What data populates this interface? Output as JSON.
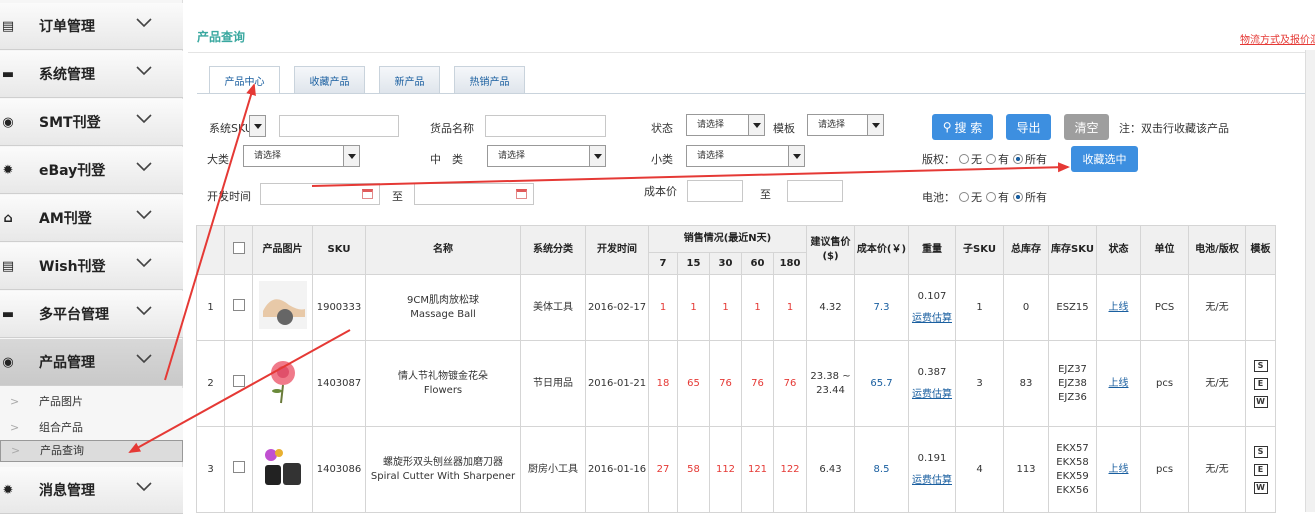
{
  "sidebar": {
    "menus": [
      {
        "label": "订单管理",
        "icon": "document-icon",
        "glyph": "▤"
      },
      {
        "label": "系统管理",
        "icon": "folder-icon",
        "glyph": "▬"
      },
      {
        "label": "SMT刊登",
        "icon": "target-icon",
        "glyph": "◉"
      },
      {
        "label": "eBay刊登",
        "icon": "gear-icon",
        "glyph": "✹"
      },
      {
        "label": "AM刊登",
        "icon": "layers-icon",
        "glyph": "⌂"
      },
      {
        "label": "Wish刊登",
        "icon": "document-icon",
        "glyph": "▤"
      },
      {
        "label": "多平台管理",
        "icon": "folder-icon",
        "glyph": "▬"
      },
      {
        "label": "产品管理",
        "icon": "target-icon",
        "glyph": "◉"
      },
      {
        "label": "消息管理",
        "icon": "gear-icon",
        "glyph": "✹"
      }
    ],
    "submenu": [
      {
        "label": "产品图片"
      },
      {
        "label": "组合产品"
      },
      {
        "label": "产品查询"
      }
    ]
  },
  "page": {
    "title": "产品查询",
    "top_link": "物流方式及报价汇"
  },
  "tabs": [
    {
      "label": "产品中心"
    },
    {
      "label": "收藏产品"
    },
    {
      "label": "新产品"
    },
    {
      "label": "热销产品"
    }
  ],
  "filters": {
    "sys_sku_label": "系统SKU",
    "name_label": "货品名称",
    "status_label": "状态",
    "status_value": "请选择",
    "template_label": "模板",
    "template_value": "请选择",
    "big_label": "大类",
    "big_value": "请选择",
    "mid_label": "中　类",
    "mid_value": "请选择",
    "small_label": "小类",
    "small_value": "请选择",
    "dev_time_label": "开发时间",
    "to_label": "至",
    "cost_label": "成本价",
    "cost_to_label": "至",
    "copyright_label": "版权：",
    "battery_label": "电池：",
    "radio_none": "无",
    "radio_yes": "有",
    "radio_all": "所有",
    "search_btn": "搜 索",
    "export_btn": "导出",
    "clear_btn": "清空",
    "note": "注：双击行收藏该产品",
    "collect_btn": "收藏选中"
  },
  "colors": {
    "primary_btn": "#3d8fe0",
    "clear_btn": "#9e9e9e",
    "accent_teal": "#3aa8a0",
    "red_text": "#e53935",
    "link_blue": "#1a5fa0",
    "arrow_red": "#e53935"
  },
  "table": {
    "headers": {
      "no": "",
      "img": "产品图片",
      "sku": "SKU",
      "name": "名称",
      "cat": "系统分类",
      "dev": "开发时间",
      "sales": "销售情况(最近N天)",
      "d7": "7",
      "d15": "15",
      "d30": "30",
      "d60": "60",
      "d180": "180",
      "price": "建议售价($)",
      "cost": "成本价(￥)",
      "weight": "重量",
      "subsku": "子SKU",
      "stock": "总库存",
      "stocksku": "库存SKU",
      "status": "状态",
      "unit": "单位",
      "battery": "电池/版权",
      "ops": "模板"
    },
    "rows": [
      {
        "no": "1",
        "sku": "1900333",
        "name_cn": "9CM肌肉放松球",
        "name_en": "Massage Ball",
        "cat": "美体工具",
        "dev": "2016-02-17",
        "s7": "1",
        "s15": "1",
        "s30": "1",
        "s60": "1",
        "s180": "1",
        "price": "4.32",
        "cost": "7.3",
        "weight": "0.107",
        "freight": "运费估算",
        "subsku": "1",
        "stock": "0",
        "stocksku": "ESZ15",
        "status": "上线",
        "unit": "PCS",
        "battery": "无/无"
      },
      {
        "no": "2",
        "sku": "1403087",
        "name_cn": "情人节礼物镀金花朵",
        "name_en": "Flowers",
        "cat": "节日用品",
        "dev": "2016-01-21",
        "s7": "18",
        "s15": "65",
        "s30": "76",
        "s60": "76",
        "s180": "76",
        "price": "23.38 ~ 23.44",
        "cost": "65.7",
        "weight": "0.387",
        "freight": "运费估算",
        "subsku": "3",
        "stock": "83",
        "stocksku": "EJZ37 EJZ38 EJZ36",
        "status": "上线",
        "unit": "pcs",
        "battery": "无/无"
      },
      {
        "no": "3",
        "sku": "1403086",
        "name_cn": "螺旋形双头刨丝器加磨刀器",
        "name_en": "Spiral Cutter With Sharpener",
        "cat": "厨房小工具",
        "dev": "2016-01-16",
        "s7": "27",
        "s15": "58",
        "s30": "112",
        "s60": "121",
        "s180": "122",
        "price": "6.43",
        "cost": "8.5",
        "weight": "0.191",
        "freight": "运费估算",
        "subsku": "4",
        "stock": "113",
        "stocksku": "EKX57 EKX58 EKX59 EKX56",
        "status": "上线",
        "unit": "pcs",
        "battery": "无/无"
      }
    ]
  }
}
